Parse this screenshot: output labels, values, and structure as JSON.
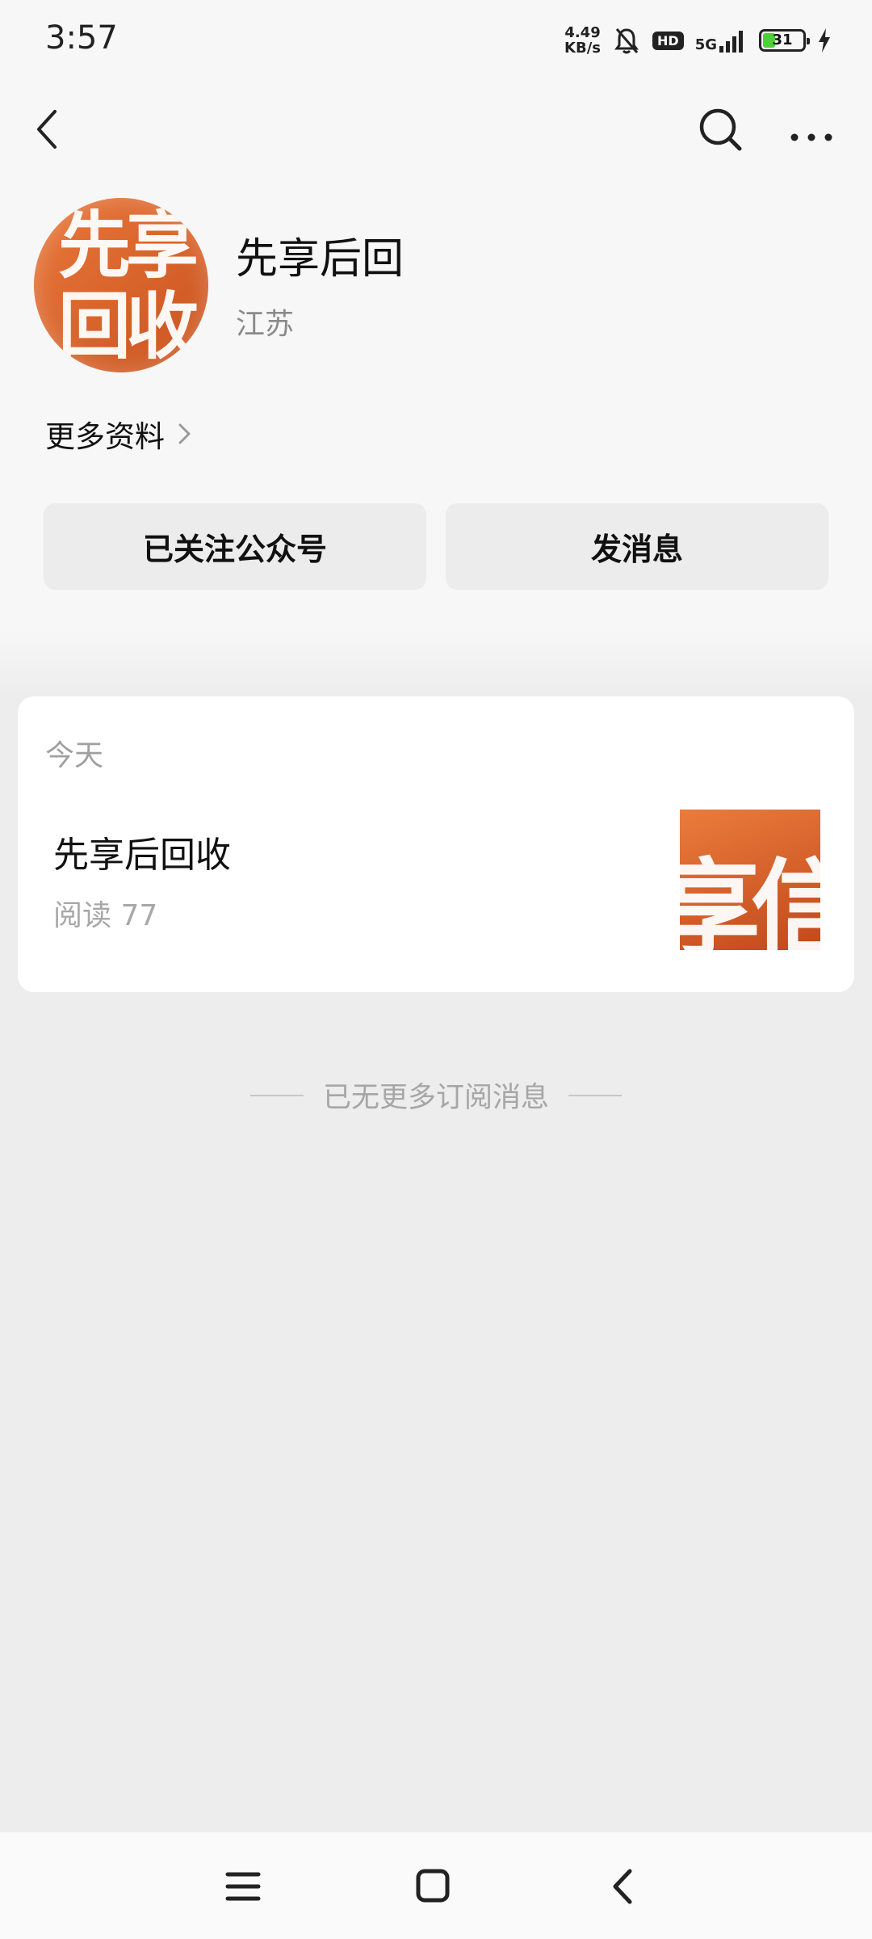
{
  "status_bar": {
    "time": "3:57",
    "net_speed_value": "4.49",
    "net_speed_unit": "KB/s",
    "network": "5G",
    "hd": "HD",
    "battery_level": "31",
    "battery_fraction": 0.31,
    "icons": [
      "bell-muted-icon",
      "hd-icon",
      "signal-icon",
      "battery-icon",
      "charging-icon"
    ]
  },
  "nav": {
    "icons": [
      "back-arrow-icon",
      "search-icon",
      "more-icon"
    ]
  },
  "profile": {
    "name": "先享后回",
    "region": "江苏",
    "avatar_text": [
      "先享",
      "回收"
    ],
    "more_info_label": "更多资料"
  },
  "actions": {
    "follow_label": "已关注公众号",
    "message_label": "发消息"
  },
  "feed": {
    "date_label": "今天",
    "articles": [
      {
        "title": "先享后回收",
        "reads": "阅读 77",
        "thumb_text": "享信"
      }
    ],
    "end_label": "已无更多订阅消息"
  },
  "system_nav": {
    "icons": [
      "menu-icon",
      "home-icon",
      "back-icon"
    ]
  },
  "colors": {
    "page_bg": "#ededed",
    "header_bg": "#f7f7f7",
    "button_bg": "#ececec",
    "avatar_orange": "#e9773a",
    "battery_green": "#4cd137"
  }
}
